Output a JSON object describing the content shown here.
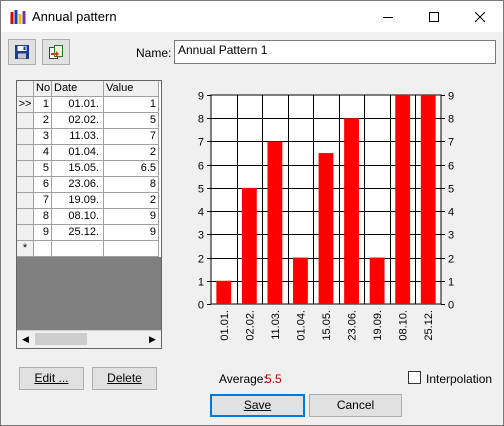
{
  "window": {
    "title": "Annual pattern",
    "minimize_icon": "minimize-icon",
    "maximize_icon": "maximize-icon",
    "close_icon": "close-icon"
  },
  "toolbar": {
    "save_icon": "floppy-disk-icon",
    "export_icon": "export-icon"
  },
  "name": {
    "label": "Name:",
    "value": "Annual Pattern 1"
  },
  "table": {
    "columns": [
      "No",
      "Date",
      "Value"
    ],
    "rows": [
      {
        "marker": ">>",
        "no": "1",
        "date": "01.01.",
        "value": "1"
      },
      {
        "marker": "",
        "no": "2",
        "date": "02.02.",
        "value": "5"
      },
      {
        "marker": "",
        "no": "3",
        "date": "11.03.",
        "value": "7"
      },
      {
        "marker": "",
        "no": "4",
        "date": "01.04.",
        "value": "2"
      },
      {
        "marker": "",
        "no": "5",
        "date": "15.05.",
        "value": "6.5"
      },
      {
        "marker": "",
        "no": "6",
        "date": "23.06.",
        "value": "8"
      },
      {
        "marker": "",
        "no": "7",
        "date": "19.09.",
        "value": "2"
      },
      {
        "marker": "",
        "no": "8",
        "date": "08.10.",
        "value": "9"
      },
      {
        "marker": "",
        "no": "9",
        "date": "25.12.",
        "value": "9"
      }
    ],
    "new_row_marker": "*"
  },
  "buttons": {
    "edit": "Edit ...",
    "delete": "Delete",
    "save": "Save",
    "cancel": "Cancel"
  },
  "average": {
    "label": "Average:",
    "value": "5.5",
    "color": "#c00000"
  },
  "interpolation": {
    "label": "Interpolation",
    "checked": false
  },
  "chart_data": {
    "type": "bar",
    "categories": [
      "01.01.",
      "02.02.",
      "11.03.",
      "01.04.",
      "15.05.",
      "23.06.",
      "19.09.",
      "08.10.",
      "25.12."
    ],
    "values": [
      1,
      5,
      7,
      2,
      6.5,
      8,
      2,
      9,
      9
    ],
    "ylim": [
      0,
      9
    ],
    "yticks": [
      0,
      1,
      2,
      3,
      4,
      5,
      6,
      7,
      8,
      9
    ],
    "grid": true,
    "bar_color": "#ff0000"
  }
}
